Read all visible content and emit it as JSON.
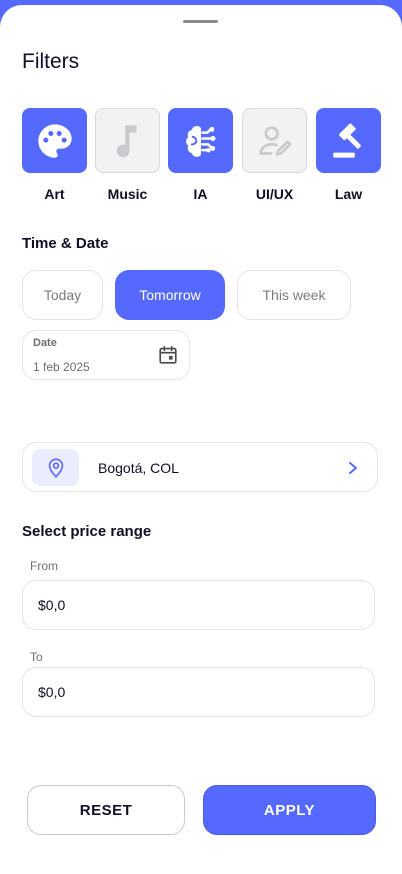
{
  "colors": {
    "accent": "#5669FF",
    "background_sheet": "#FFFFFF",
    "inactive_tile": "#F2F2F4"
  },
  "title": "Filters",
  "categories": [
    {
      "label": "Art",
      "icon": "palette-icon",
      "active": true
    },
    {
      "label": "Music",
      "icon": "music-note-icon",
      "active": false
    },
    {
      "label": "IA",
      "icon": "brain-circuit-icon",
      "active": true
    },
    {
      "label": "UI/UX",
      "icon": "user-edit-icon",
      "active": false
    },
    {
      "label": "Law",
      "icon": "gavel-icon",
      "active": true
    }
  ],
  "time_date": {
    "title": "Time & Date",
    "options": [
      {
        "label": "Today",
        "active": false
      },
      {
        "label": "Tomorrow",
        "active": true
      },
      {
        "label": "This week",
        "active": false
      }
    ],
    "date_label": "Date",
    "date_value": "1 feb 2025"
  },
  "location": {
    "value": "Bogotá, COL"
  },
  "price": {
    "title": "Select price range",
    "from_label": "From",
    "from_value": "$0,0",
    "to_label": "To",
    "to_value": "$0,0"
  },
  "actions": {
    "reset_label": "RESET",
    "apply_label": "APPLY"
  }
}
